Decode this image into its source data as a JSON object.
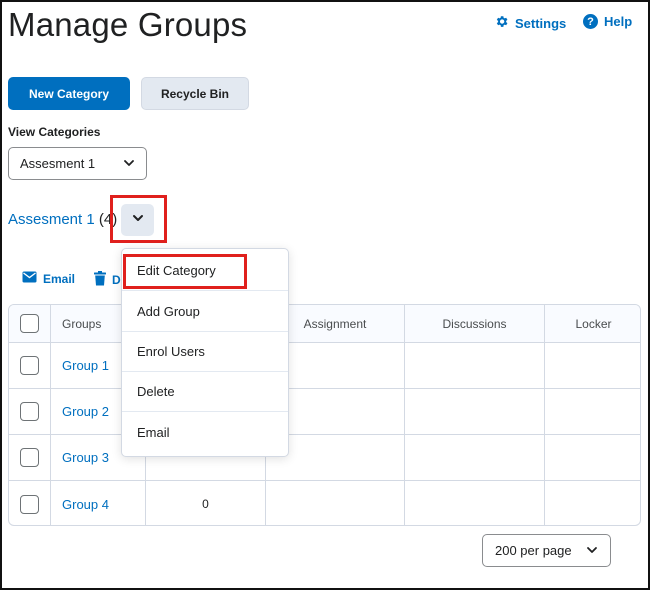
{
  "header": {
    "title": "Manage Groups",
    "settings_label": "Settings",
    "help_label": "Help",
    "help_glyph": "?"
  },
  "toolbar": {
    "new_category_label": "New Category",
    "recycle_bin_label": "Recycle Bin"
  },
  "view_categories": {
    "label": "View Categories",
    "selected": "Assesment 1"
  },
  "category": {
    "name": "Assesment 1",
    "count": "(4)"
  },
  "actions": {
    "email_label": "Email",
    "delete_label": "D"
  },
  "table": {
    "columns": [
      "Groups",
      "Assignment",
      "Discussions",
      "Locker"
    ],
    "rows": [
      {
        "group": "Group 1",
        "members": ""
      },
      {
        "group": "Group 2",
        "members": ""
      },
      {
        "group": "Group 3",
        "members": ""
      },
      {
        "group": "Group 4",
        "members": "0"
      }
    ]
  },
  "dropdown_menu": {
    "items": [
      "Edit Category",
      "Add Group",
      "Enrol Users",
      "Delete",
      "Email"
    ]
  },
  "pagination": {
    "per_page": "200 per page"
  },
  "colors": {
    "accent": "#006fbf",
    "highlight": "#e0201d",
    "secondary_button": "#e3e9f1"
  },
  "icons": [
    "settings-gear-icon",
    "help-circle-icon",
    "chevron-down-icon",
    "email-envelope-icon",
    "delete-trash-icon"
  ]
}
